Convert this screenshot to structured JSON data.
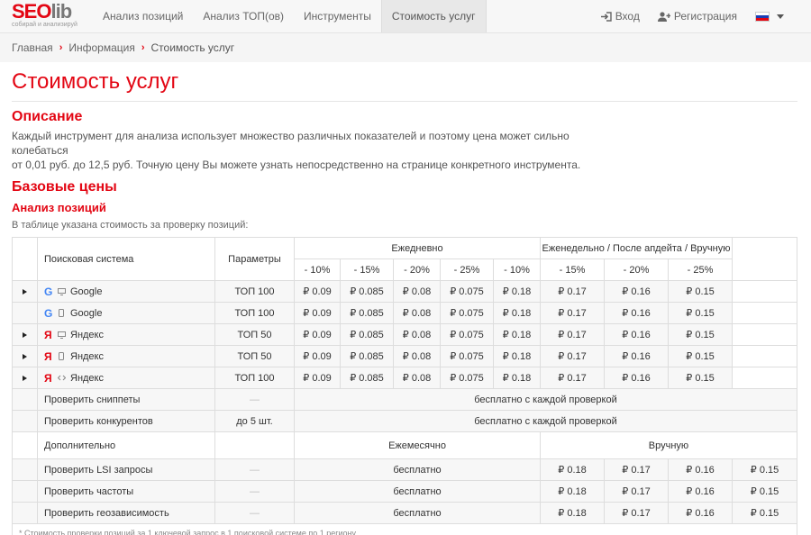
{
  "logo": {
    "seo": "SEO",
    "lib": "lib",
    "tagline": "собирай и анализируй"
  },
  "nav": {
    "items": [
      {
        "label": "Анализ позиций"
      },
      {
        "label": "Анализ ТОП(ов)"
      },
      {
        "label": "Инструменты"
      },
      {
        "label": "Стоимость услуг"
      }
    ],
    "active_index": 3,
    "login": "Вход",
    "register": "Регистрация",
    "language_icon": "flag-ru-icon"
  },
  "breadcrumb": {
    "items": [
      "Главная",
      "Информация",
      "Стоимость услуг"
    ]
  },
  "page": {
    "title": "Стоимость услуг",
    "description_heading": "Описание",
    "description_line1": "Каждый инструмент для анализа использует множество различных показателей и поэтому цена может сильно колебаться",
    "description_line2": "от 0,01 руб. до 12,5 руб. Точную цену Вы можете узнать непосредственно на странице конкретного инструмента.",
    "base_prices_heading": "Базовые цены",
    "positions_heading": "Анализ позиций",
    "table_note": "В таблице указана стоимость за проверку позиций:"
  },
  "table": {
    "col_engine": "Поисковая система",
    "col_params": "Параметры",
    "col_daily": "Ежедневно",
    "col_weekly": "Еженедельно / После апдейта / Вручную",
    "daily_discounts": [
      "- 10%",
      "- 15%",
      "- 20%",
      "- 25%",
      "- 10%"
    ],
    "weekly_discounts": [
      "- 15%",
      "- 20%",
      "- 25%"
    ],
    "rows": [
      {
        "engine": "Google",
        "engine_icon": "google-icon",
        "device_icon": "desktop-icon",
        "expandable": true,
        "params": "ТОП 100",
        "daily": [
          "₽ 0.09",
          "₽ 0.085",
          "₽ 0.08",
          "₽ 0.075",
          "₽ 0.18"
        ],
        "weekly": [
          "₽ 0.17",
          "₽ 0.16",
          "₽ 0.15"
        ]
      },
      {
        "engine": "Google",
        "engine_icon": "google-icon",
        "device_icon": "mobile-icon",
        "expandable": false,
        "params": "ТОП 100",
        "daily": [
          "₽ 0.09",
          "₽ 0.085",
          "₽ 0.08",
          "₽ 0.075",
          "₽ 0.18"
        ],
        "weekly": [
          "₽ 0.17",
          "₽ 0.16",
          "₽ 0.15"
        ]
      },
      {
        "engine": "Яндекс",
        "engine_icon": "yandex-icon",
        "device_icon": "desktop-icon",
        "expandable": true,
        "params": "ТОП 50",
        "daily": [
          "₽ 0.09",
          "₽ 0.085",
          "₽ 0.08",
          "₽ 0.075",
          "₽ 0.18"
        ],
        "weekly": [
          "₽ 0.17",
          "₽ 0.16",
          "₽ 0.15"
        ]
      },
      {
        "engine": "Яндекс",
        "engine_icon": "yandex-icon",
        "device_icon": "mobile-icon",
        "expandable": true,
        "params": "ТОП 50",
        "daily": [
          "₽ 0.09",
          "₽ 0.085",
          "₽ 0.08",
          "₽ 0.075",
          "₽ 0.18"
        ],
        "weekly": [
          "₽ 0.17",
          "₽ 0.16",
          "₽ 0.15"
        ]
      },
      {
        "engine": "Яндекс",
        "engine_icon": "yandex-icon",
        "device_icon": "code-icon",
        "expandable": true,
        "params": "ТОП 100",
        "daily": [
          "₽ 0.09",
          "₽ 0.085",
          "₽ 0.08",
          "₽ 0.075",
          "₽ 0.18"
        ],
        "weekly": [
          "₽ 0.17",
          "₽ 0.16",
          "₽ 0.15"
        ]
      }
    ],
    "free_rows": [
      {
        "label": "Проверить сниппеты",
        "params": "—",
        "value": "бесплатно с каждой проверкой"
      },
      {
        "label": "Проверить конкурентов",
        "params": "до 5 шт.",
        "value": "бесплатно с каждой проверкой"
      }
    ],
    "extra_header": {
      "label": "Дополнительно",
      "monthly": "Ежемесячно",
      "manual": "Вручную"
    },
    "extra_rows": [
      {
        "label": "Проверить LSI запросы",
        "params": "—",
        "monthly": "бесплатно",
        "manual": [
          "₽ 0.18",
          "₽ 0.17",
          "₽ 0.16",
          "₽ 0.15"
        ]
      },
      {
        "label": "Проверить частоты",
        "params": "—",
        "monthly": "бесплатно",
        "manual": [
          "₽ 0.18",
          "₽ 0.17",
          "₽ 0.16",
          "₽ 0.15"
        ]
      },
      {
        "label": "Проверить геозависимость",
        "params": "—",
        "monthly": "бесплатно",
        "manual": [
          "₽ 0.18",
          "₽ 0.17",
          "₽ 0.16",
          "₽ 0.15"
        ]
      }
    ],
    "footnote": "* Стоимость проверки позиций за 1 ключевой запрос в 1 поисковой системе по 1 региону"
  },
  "colors": {
    "accent": "#e30613",
    "google": "#4285f4",
    "border": "#dddddd"
  }
}
